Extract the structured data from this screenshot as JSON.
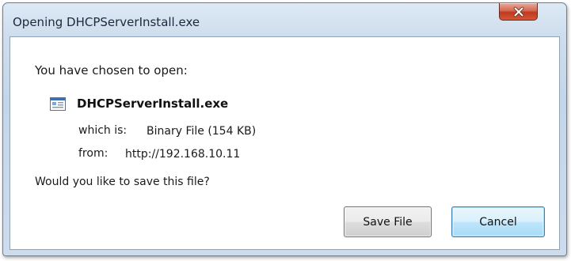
{
  "window": {
    "title": "Opening DHCPServerInstall.exe"
  },
  "dialog": {
    "intro": "You have chosen to open:",
    "file_name": "DHCPServerInstall.exe",
    "file_icon": "file-icon",
    "which_label": "which is:",
    "which_value": "Binary File (154 KB)",
    "from_label": "from:",
    "from_value": "http://192.168.10.11",
    "question": "Would you like to save this file?"
  },
  "buttons": {
    "save_label": "Save File",
    "cancel_label": "Cancel",
    "close_icon": "close-icon"
  },
  "colors": {
    "close_button": "#c1391e",
    "focused_button_border": "#3c7fb1"
  }
}
